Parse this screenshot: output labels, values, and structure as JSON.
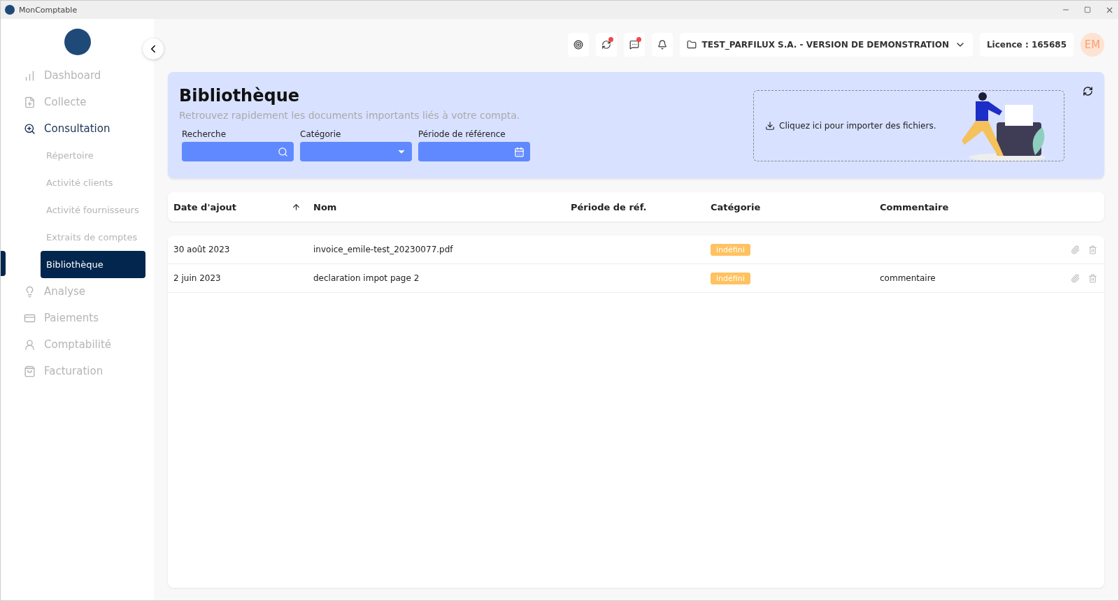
{
  "window": {
    "title": "MonComptable"
  },
  "sidebar": {
    "items": [
      {
        "label": "Dashboard",
        "selected": false
      },
      {
        "label": "Collecte",
        "selected": false
      },
      {
        "label": "Consultation",
        "selected": true,
        "expanded": true,
        "children": [
          {
            "label": "Répertoire",
            "selected": false
          },
          {
            "label": "Activité clients",
            "selected": false
          },
          {
            "label": "Activité fournisseurs",
            "selected": false
          },
          {
            "label": "Extraits de comptes",
            "selected": false
          },
          {
            "label": "Bibliothèque",
            "selected": true
          }
        ]
      },
      {
        "label": "Analyse",
        "selected": false
      },
      {
        "label": "Paiements",
        "selected": false
      },
      {
        "label": "Comptabilité",
        "selected": false
      },
      {
        "label": "Facturation",
        "selected": false
      }
    ]
  },
  "topbar": {
    "icons": [
      {
        "notification": false
      },
      {
        "notification": true
      },
      {
        "notification": true
      },
      {
        "notification": false
      }
    ],
    "company": "TEST_PARFILUX S.A. - VERSION DE DEMONSTRATION",
    "license": "Licence : 165685",
    "avatar": "EM"
  },
  "banner": {
    "title": "Bibliothèque",
    "subtitle": "Retrouvez rapidement les documents importants liés à votre compta.",
    "filters": [
      {
        "label": "Recherche",
        "kind": "search"
      },
      {
        "label": "Catégorie",
        "kind": "select"
      },
      {
        "label": "Période de référence",
        "kind": "date"
      }
    ],
    "import_text": "Cliquez ici pour importer des fichiers."
  },
  "table": {
    "columns": [
      {
        "label": "Date d'ajout",
        "sorted": true
      },
      {
        "label": "Nom",
        "sorted": false
      },
      {
        "label": "Période de réf.",
        "sorted": false
      },
      {
        "label": "Catégorie",
        "sorted": false
      },
      {
        "label": "Commentaire",
        "sorted": false
      }
    ],
    "rows": [
      {
        "date": "30 août 2023",
        "name": "invoice_emile-test_20230077.pdf",
        "category": "indéfini",
        "comment": ""
      },
      {
        "date": "2 juin 2023",
        "name": "declaration impot page 2",
        "category": "indéfini",
        "comment": "commentaire"
      }
    ]
  }
}
